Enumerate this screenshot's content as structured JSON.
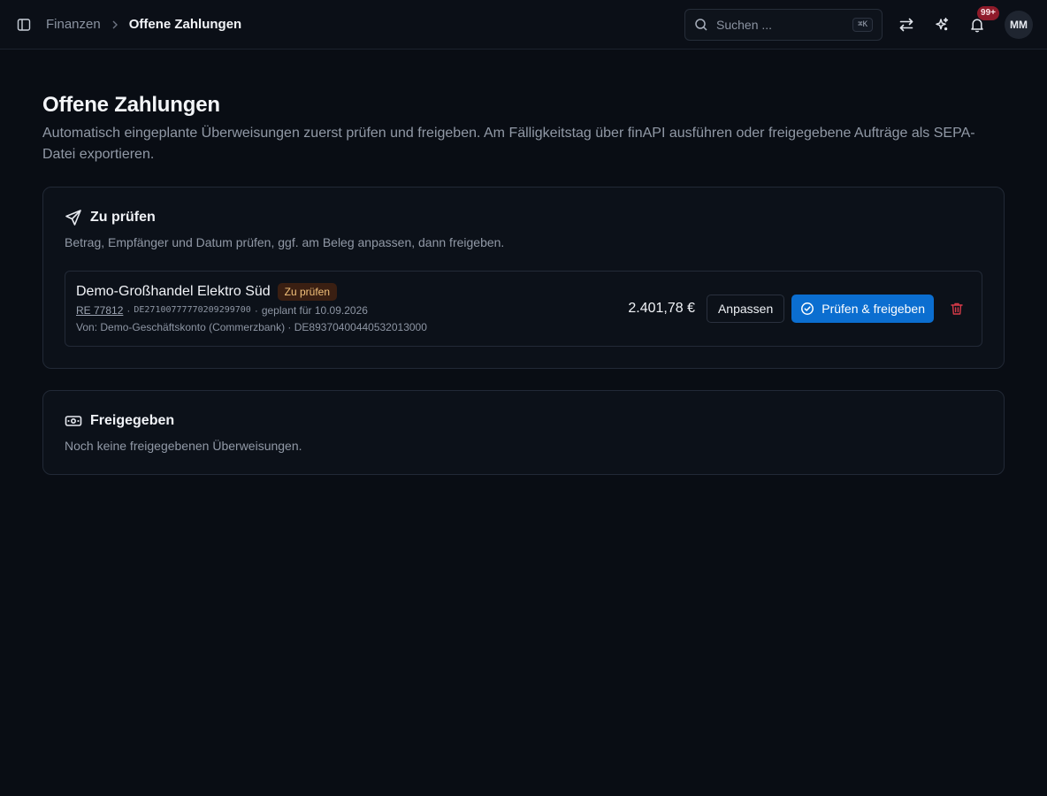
{
  "colors": {
    "background": "#090d14",
    "primary": "#0b6ed0",
    "danger": "#d63a48",
    "badge_bg": "#3a1f12",
    "badge_text": "#f2c07a",
    "notif_badge": "#8f1b2a"
  },
  "header": {
    "breadcrumb": {
      "parent": "Finanzen",
      "current": "Offene Zahlungen"
    },
    "search": {
      "placeholder": "Suchen ...",
      "shortcut": "⌘K"
    },
    "notifications": {
      "count": "99+"
    },
    "user": {
      "initials": "MM"
    },
    "icons": [
      "sidebar-toggle-icon",
      "chevron-right-icon",
      "search-icon",
      "switch-arrows-icon",
      "sparkles-icon",
      "bell-icon"
    ]
  },
  "page": {
    "title": "Offene Zahlungen",
    "description": "Automatisch eingeplante Überweisungen zuerst prüfen und freigeben. Am Fälligkeitstag über finAPI ausführen oder freigegebene Aufträge als SEPA-Datei exportieren."
  },
  "review_section": {
    "title": "Zu prüfen",
    "description": "Betrag, Empfänger und Datum prüfen, ggf. am Beleg anpassen, dann freigeben.",
    "icon": "send-icon",
    "payments": [
      {
        "recipient": "Demo-Großhandel Elektro Süd",
        "status": "Zu prüfen",
        "reference": "RE 77812",
        "iban": "DE27100777770209299700",
        "scheduled": "geplant für 10.09.2026",
        "from": "Von: Demo-Geschäftskonto (Commerzbank) · DE89370400440532013000",
        "amount": "2.401,78 €",
        "adjust_label": "Anpassen",
        "approve_label": "Prüfen & freigeben"
      }
    ]
  },
  "approved_section": {
    "title": "Freigegeben",
    "description": "Noch keine freigegebenen Überweisungen.",
    "icon": "banknote-icon"
  }
}
